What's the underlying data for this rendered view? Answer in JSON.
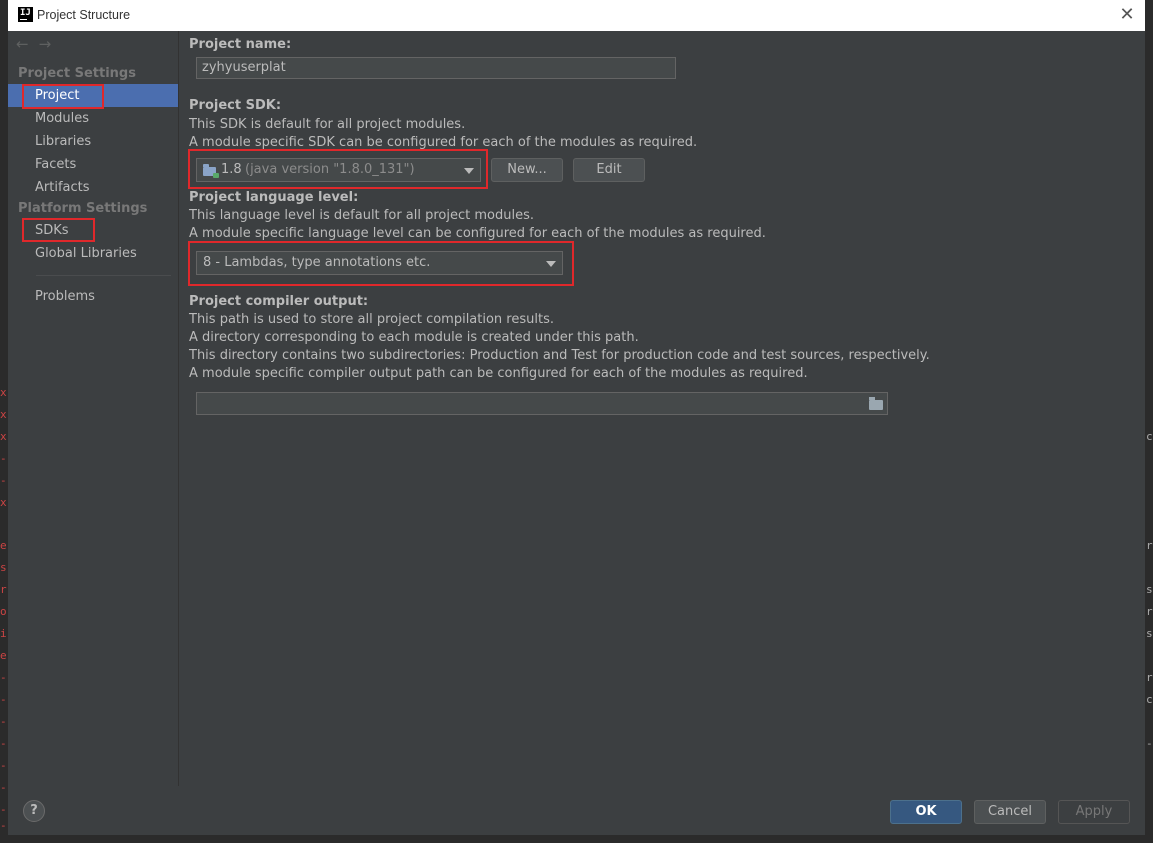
{
  "window": {
    "title": "Project Structure",
    "app_icon_text": "IJ"
  },
  "background_marks": {
    "left": [
      "x",
      "x",
      "x",
      "-",
      "-",
      "x",
      "e",
      "s",
      "r",
      "o",
      "i",
      "e",
      "-",
      "-",
      "-",
      "-",
      "-",
      "-",
      "-",
      "-",
      "-"
    ],
    "right": [
      "c",
      "r",
      "s",
      "r",
      "s",
      "r",
      "c",
      "-"
    ]
  },
  "sidebar": {
    "nav_back": "←",
    "nav_forward": "→",
    "project_settings_title": "Project Settings",
    "project_settings_items": [
      "Project",
      "Modules",
      "Libraries",
      "Facets",
      "Artifacts"
    ],
    "platform_settings_title": "Platform Settings",
    "platform_settings_items": [
      "SDKs",
      "Global Libraries"
    ],
    "problems_label": "Problems",
    "selected": "Project"
  },
  "project_name": {
    "label": "Project name:",
    "value": "zyhyuserplat"
  },
  "project_sdk": {
    "label": "Project SDK:",
    "desc1": "This SDK is default for all project modules.",
    "desc2": "A module specific SDK can be configured for each of the modules as required.",
    "selected_version": "1.8",
    "selected_detail": "(java version \"1.8.0_131\")",
    "new_button": "New...",
    "edit_button": "Edit"
  },
  "language_level": {
    "label": "Project language level:",
    "desc1": "This language level is default for all project modules.",
    "desc2": "A module specific language level can be configured for each of the modules as required.",
    "selected": "8 - Lambdas, type annotations etc."
  },
  "compiler_output": {
    "label": "Project compiler output:",
    "desc1": "This path is used to store all project compilation results.",
    "desc2": "A directory corresponding to each module is created under this path.",
    "desc3": "This directory contains two subdirectories: Production and Test for production code and test sources, respectively.",
    "desc4": "A module specific compiler output path can be configured for each of the modules as required.",
    "value": ""
  },
  "footer": {
    "help_label": "?",
    "ok_label": "OK",
    "cancel_label": "Cancel",
    "apply_label": "Apply"
  },
  "colors": {
    "selection": "#4b6eaf",
    "highlight_box": "#e0282b",
    "ok_button": "#365880"
  }
}
